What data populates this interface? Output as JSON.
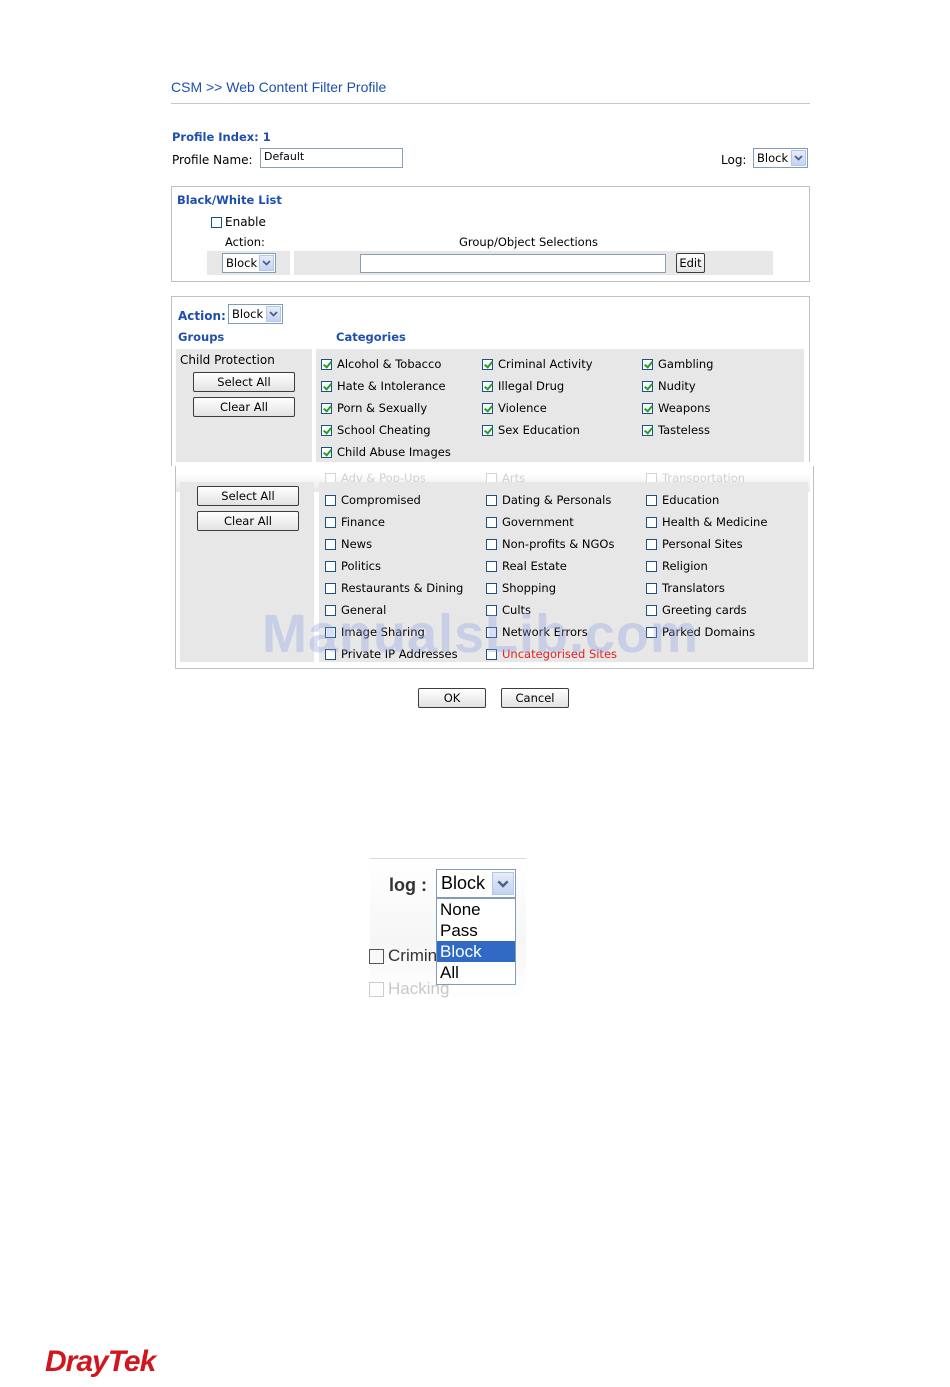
{
  "header": {
    "title": "CSM >> Web Content Filter Profile"
  },
  "profile": {
    "index_label": "Profile Index: 1",
    "name_label": "Profile Name:",
    "name_value": "Default",
    "log_label": "Log:",
    "log_value": "Block"
  },
  "bwlist": {
    "title": "Black/White List",
    "enable_label": "Enable",
    "action_label": "Action:",
    "group_label": "Group/Object Selections",
    "action_value": "Block",
    "edit_label": "Edit"
  },
  "main": {
    "action_label": "Action:",
    "action_value": "Block",
    "groups_header": "Groups",
    "categories_header": "Categories",
    "group1": {
      "name": "Child Protection",
      "select_all": "Select All",
      "clear_all": "Clear All",
      "items": [
        "Alcohol & Tobacco",
        "Criminal Activity",
        "Gambling",
        "Hate & Intolerance",
        "Illegal Drug",
        "Nudity",
        "Porn & Sexually",
        "Violence",
        "Weapons",
        "School Cheating",
        "Sex Education",
        "Tasteless",
        "Child Abuse Images"
      ]
    },
    "group2": {
      "select_all": "Select All",
      "clear_all": "Clear All",
      "faded": [
        "Adv & Pop-Ups",
        "Arts",
        "Transportation"
      ],
      "items": [
        "Compromised",
        "Dating & Personals",
        "Education",
        "Finance",
        "Government",
        "Health & Medicine",
        "News",
        "Non-profits & NGOs",
        "Personal Sites",
        "Politics",
        "Real Estate",
        "Religion",
        "Restaurants & Dining",
        "Shopping",
        "Translators",
        "General",
        "Cults",
        "Greeting cards",
        "Image Sharing",
        "Network Errors",
        "Parked Domains",
        "Private IP Addresses",
        "Uncategorised Sites"
      ]
    }
  },
  "footer": {
    "ok_label": "OK",
    "cancel_label": "Cancel"
  },
  "watermark": "ManualsLib.com",
  "log_zoom": {
    "label": "log :",
    "value": "Block",
    "options": [
      "None",
      "Pass",
      "Block",
      "All"
    ],
    "selected": "Block",
    "behind": [
      "Crimin",
      "Hacking"
    ]
  },
  "brand": {
    "logo": "DrayTek"
  },
  "colors": {
    "accent": "#1f4fae",
    "selection": "#316ac5",
    "logo": "#d0161e",
    "check": "#21a121",
    "red_text": "#e02020"
  }
}
